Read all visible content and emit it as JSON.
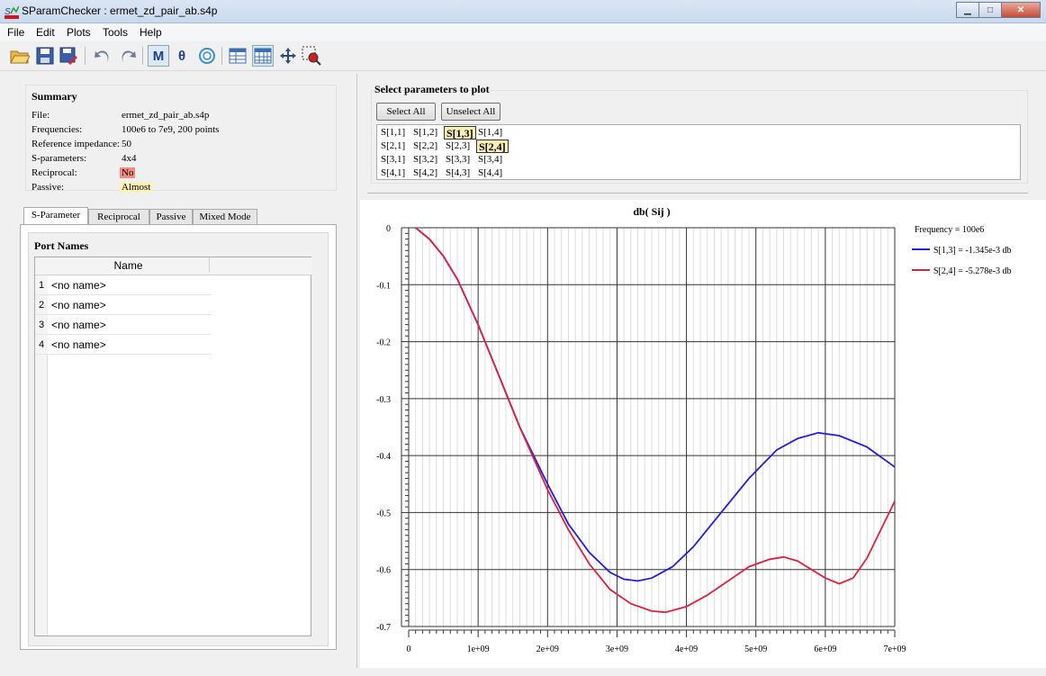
{
  "window": {
    "title": "SParamChecker : ermet_zd_pair_ab.s4p",
    "minimize_glyph": "▁",
    "maximize_glyph": "□",
    "close_glyph": "✕"
  },
  "menu": [
    "File",
    "Edit",
    "Plots",
    "Tools",
    "Help"
  ],
  "toolbar": {
    "icons": [
      "open-folder-icon",
      "save-icon",
      "save-as-icon",
      "undo-icon",
      "redo-icon",
      "magnitude-icon",
      "phase-icon",
      "smith-chart-icon",
      "table-icon",
      "grid-icon",
      "pan-icon",
      "zoom-icon"
    ],
    "magnitude_label": "M",
    "phase_label": "θ"
  },
  "summary": {
    "heading": "Summary",
    "rows": [
      {
        "key": "File:",
        "value": "ermet_zd_pair_ab.s4p"
      },
      {
        "key": "Frequencies:",
        "value": "100e6 to 7e9, 200 points"
      },
      {
        "key": "Reference impedance:",
        "value": "50"
      },
      {
        "key": "S-parameters:",
        "value": "4x4"
      },
      {
        "key": "Reciprocal:",
        "value": "No",
        "highlight": "#f08c80"
      },
      {
        "key": "Passive:",
        "value": "Almost",
        "highlight": "#fff2b8"
      }
    ]
  },
  "tabs": [
    "S-Parameter",
    "Reciprocal",
    "Passive",
    "Mixed Mode"
  ],
  "ports": {
    "heading": "Port Names",
    "column": "Name",
    "rows": [
      {
        "num": "1",
        "name": "<no name>"
      },
      {
        "num": "2",
        "name": "<no name>"
      },
      {
        "num": "3",
        "name": "<no name>"
      },
      {
        "num": "4",
        "name": "<no name>"
      }
    ]
  },
  "params": {
    "heading": "Select parameters to plot",
    "select_all": "Select All",
    "unselect_all": "Unselect All",
    "grid": [
      [
        "S[1,1]",
        "S[1,2]",
        "S[1,3]",
        "S[1,4]"
      ],
      [
        "S[2,1]",
        "S[2,2]",
        "S[2,3]",
        "S[2,4]"
      ],
      [
        "S[3,1]",
        "S[3,2]",
        "S[3,3]",
        "S[3,4]"
      ],
      [
        "S[4,1]",
        "S[4,2]",
        "S[4,3]",
        "S[4,4]"
      ]
    ],
    "selected": [
      "S[1,3]",
      "S[2,4]"
    ]
  },
  "chart_data": {
    "type": "line",
    "title": "db( Sij )",
    "xlim": [
      0,
      7000000000
    ],
    "ylim": [
      -0.7,
      0
    ],
    "xticks": [
      "0",
      "1e+09",
      "2e+09",
      "3e+09",
      "4e+09",
      "5e+09",
      "6e+09",
      "7e+09"
    ],
    "yticks": [
      "0",
      "-0.1",
      "-0.2",
      "-0.3",
      "-0.4",
      "-0.5",
      "-0.6",
      "-0.7"
    ],
    "grid": true,
    "legend_position": "right",
    "legend_title": "Frequency = 100e6",
    "series": [
      {
        "name": "S[1,3] = -1.345e-3 db",
        "color": "#1f1fe0",
        "x": [
          100000000,
          300000000,
          500000000,
          700000000,
          1000000000,
          1300000000,
          1600000000,
          2000000000,
          2300000000,
          2600000000,
          2900000000,
          3100000000,
          3300000000,
          3500000000,
          3800000000,
          4100000000,
          4500000000,
          4900000000,
          5300000000,
          5600000000,
          5900000000,
          6200000000,
          6600000000,
          7000000000
        ],
        "y": [
          0.0,
          -0.02,
          -0.05,
          -0.09,
          -0.17,
          -0.26,
          -0.35,
          -0.45,
          -0.52,
          -0.57,
          -0.605,
          -0.617,
          -0.62,
          -0.615,
          -0.595,
          -0.56,
          -0.5,
          -0.44,
          -0.39,
          -0.37,
          -0.36,
          -0.365,
          -0.385,
          -0.42
        ]
      },
      {
        "name": "S[2,4] = -5.278e-3 db",
        "color": "#e0203c",
        "x": [
          100000000,
          300000000,
          500000000,
          700000000,
          1000000000,
          1300000000,
          1600000000,
          2000000000,
          2300000000,
          2600000000,
          2900000000,
          3200000000,
          3500000000,
          3700000000,
          4000000000,
          4300000000,
          4600000000,
          4900000000,
          5200000000,
          5400000000,
          5600000000,
          5800000000,
          6000000000,
          6200000000,
          6400000000,
          6600000000,
          6800000000,
          7000000000
        ],
        "y": [
          0.0,
          -0.02,
          -0.05,
          -0.09,
          -0.17,
          -0.26,
          -0.35,
          -0.46,
          -0.53,
          -0.59,
          -0.635,
          -0.66,
          -0.673,
          -0.675,
          -0.665,
          -0.645,
          -0.62,
          -0.595,
          -0.582,
          -0.578,
          -0.585,
          -0.6,
          -0.615,
          -0.625,
          -0.615,
          -0.58,
          -0.53,
          -0.48
        ]
      }
    ]
  }
}
